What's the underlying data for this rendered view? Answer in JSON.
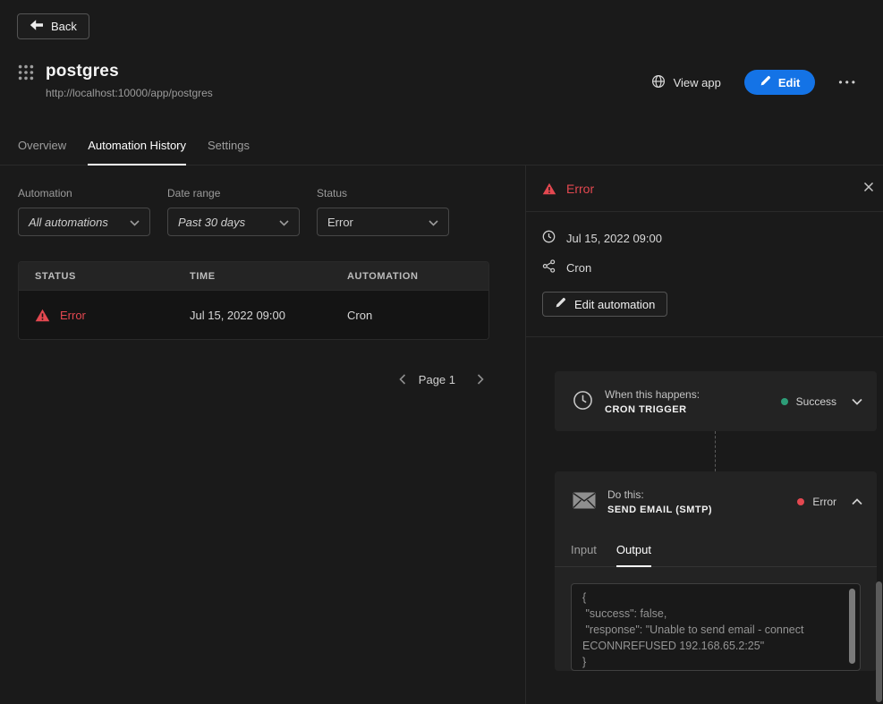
{
  "topbar": {
    "back_label": "Back"
  },
  "app_header": {
    "title": "postgres",
    "url": "http://localhost:10000/app/postgres",
    "view_app_label": "View app",
    "edit_label": "Edit",
    "more_label": "•••"
  },
  "tabs": [
    {
      "label": "Overview"
    },
    {
      "label": "Automation History"
    },
    {
      "label": "Settings"
    }
  ],
  "filters": {
    "automation": {
      "label": "Automation",
      "value": "All automations"
    },
    "date_range": {
      "label": "Date range",
      "value": "Past 30 days"
    },
    "status": {
      "label": "Status",
      "value": "Error"
    }
  },
  "history_table": {
    "columns": {
      "status": "STATUS",
      "time": "TIME",
      "automation": "AUTOMATION"
    },
    "rows": [
      {
        "status": "Error",
        "time": "Jul 15, 2022 09:00",
        "automation": "Cron"
      }
    ]
  },
  "pagination": {
    "label": "Page 1"
  },
  "detail_panel": {
    "status": "Error",
    "time": "Jul 15, 2022 09:00",
    "automation_name": "Cron",
    "edit_automation_label": "Edit automation",
    "trigger_step": {
      "heading": "When this happens:",
      "name": "CRON TRIGGER",
      "status": "Success"
    },
    "action_step": {
      "heading": "Do this:",
      "name": "SEND EMAIL (SMTP)",
      "status": "Error"
    },
    "io_tabs": {
      "input": "Input",
      "output": "Output"
    },
    "output_json": "{\n \"success\": false,\n \"response\": \"Unable to send email - connect ECONNREFUSED 192.168.65.2:25\"\n}"
  },
  "colors": {
    "accent_blue": "#1473e6",
    "error_red": "#e34850",
    "success_green": "#2d9d78"
  }
}
